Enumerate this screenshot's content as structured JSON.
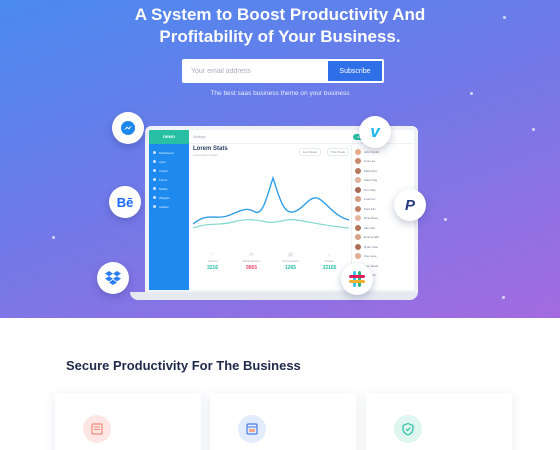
{
  "hero": {
    "title_line1": "A System to Boost Productivity And",
    "title_line2": "Profitability of Your Business.",
    "email_placeholder": "Your email address",
    "subscribe_label": "Subscribe",
    "tagline": "The best saas business theme on your business"
  },
  "app": {
    "logo": "DEMO",
    "search_label": "Activity",
    "top_pill": "Get Started",
    "sidebar_items": [
      "Dashboard",
      "Apps",
      "Charts",
      "Forms",
      "Tables",
      "Widgets",
      "Utilities"
    ],
    "stats_title": "Lorem Stats",
    "stats_subtitle": "Lorem ipsum dolor",
    "legend": [
      "Last Week",
      "This Week"
    ],
    "kpis": [
      {
        "label": "Visitors",
        "value": "3216",
        "color": "#27c0a5"
      },
      {
        "label": "Subscriptions",
        "value": "9865",
        "color": "#f0506e"
      },
      {
        "label": "Conversions",
        "value": "1265",
        "color": "#27c0a5"
      },
      {
        "label": "Orders",
        "value": "32165",
        "color": "#27c0a5"
      }
    ],
    "contacts": [
      "John Smith",
      "Ana Lee",
      "Mark Doe",
      "Sara King",
      "Tom Ray",
      "Lisa Fox",
      "Paul Kim",
      "Nina Ross",
      "Alex Wu",
      "Emma Hall",
      "Ryan Cole",
      "Zoe Lane",
      "Sam Reed",
      "Mia Park"
    ]
  },
  "floating_icons": [
    "messenger-icon",
    "behance-icon",
    "dropbox-icon",
    "vimeo-icon",
    "paypal-icon",
    "slack-icon"
  ],
  "colors": {
    "hero_start": "#4a8af0",
    "hero_end": "#a36be0",
    "accent": "#2f6fe8",
    "teal": "#27c0a5"
  },
  "section": {
    "title": "Secure Productivity For The Business"
  }
}
